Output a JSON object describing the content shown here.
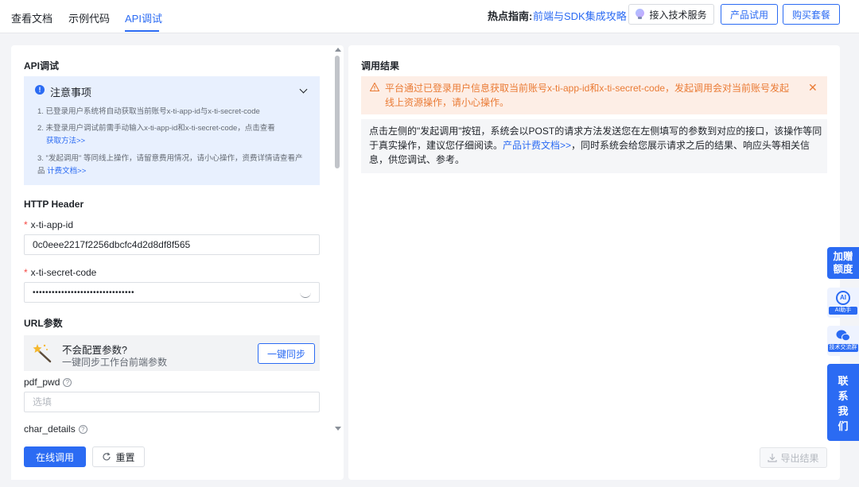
{
  "tabs": [
    {
      "label": "查看文档"
    },
    {
      "label": "示例代码"
    },
    {
      "label": "API调试",
      "active": true
    }
  ],
  "header": {
    "hot_label": "热点指南:",
    "hot_link": "前端与SDK集成攻略",
    "tech_service": "接入技术服务",
    "trial": "产品试用",
    "buy": "购买套餐"
  },
  "left": {
    "title": "API调试",
    "notice": {
      "title": "注意事项",
      "item1": "1. 已登录用户系统将自动获取当前账号x-ti-app-id与x-ti-secret-code",
      "item2": "2. 未登录用户调试前需手动输入x-ti-app-id和x-ti-secret-code，点击查看",
      "item2_link": "获取方法>>",
      "item3": "3. \"发起调用\" 等同线上操作，请留意费用情况，请小心操作，资费详情请查看产品",
      "item3_link": "计费文档>>"
    },
    "http_header_title": "HTTP Header",
    "app_id_label": "x-ti-app-id",
    "app_id_value": "0c0eee2217f2256dbcfc4d2d8df8f565",
    "secret_label": "x-ti-secret-code",
    "secret_value": "••••••••••••••••••••••••••••••••",
    "url_params_title": "URL参数",
    "sync": {
      "title": "不会配置参数?",
      "subtitle": "一键同步工作台前端参数",
      "button": "一键同步"
    },
    "pdf_pwd_label": "pdf_pwd",
    "pdf_pwd_placeholder": "选填",
    "char_details_label": "char_details",
    "call_button": "在线调用",
    "reset_button": "重置"
  },
  "right": {
    "title": "调用结果",
    "warning": "平台通过已登录用户信息获取当前账号x-ti-app-id和x-ti-secret-code，发起调用会对当前账号发起线上资源操作，请小心操作。",
    "info_part1": "点击左侧的\"发起调用\"按钮，系统会以POST的请求方法发送您在左侧填写的参数到对应的接口，该操作等同于真实操作，建议您仔细阅读。",
    "info_link": "产品计费文档>>",
    "info_part2": "，同时系统会给您展示请求之后的结果、响应头等相关信息，供您调试、参考。",
    "export_button": "导出结果"
  },
  "float": {
    "bonus": "加赠额度",
    "ai_badge": "AI",
    "ai": "AI助手",
    "group": "技术交流群",
    "contact": "联系我们"
  },
  "colors": {
    "primary": "#2b6bf3",
    "warning": "#ea7b35",
    "required": "#f54a45"
  }
}
